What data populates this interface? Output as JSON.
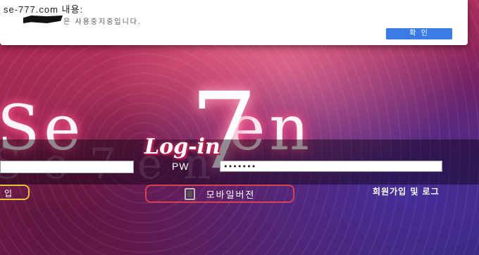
{
  "alert": {
    "title": "se-777.com 내용:",
    "message": "은 사용중지중입니다.",
    "ok_label": "확 인"
  },
  "brand": {
    "logo_text": "Se7en",
    "seven": "7"
  },
  "login": {
    "title": "Log-in",
    "id_value": "",
    "pw_label": "PW",
    "pw_value": "•••••••",
    "left_button_label": "입",
    "mobile_button_label": "모바일버전",
    "join_link": "회원가입 및 로그"
  },
  "colors": {
    "accent_yellow": "#e7c33b",
    "accent_red": "#d94152",
    "dialog_button": "#3c7be5"
  },
  "icons": [
    "phone-icon"
  ]
}
